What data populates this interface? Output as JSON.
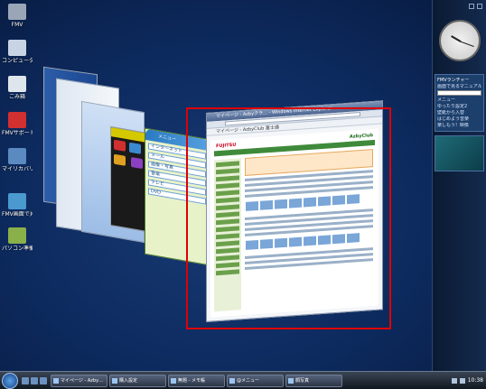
{
  "desktop_icons": [
    {
      "label": "FMV",
      "icon": "computer-icon",
      "color": "#9aa6b8"
    },
    {
      "label": "コンピュータ",
      "icon": "computer-icon",
      "color": "#c8d4e4"
    },
    {
      "label": "ごみ箱",
      "icon": "recycle-bin-icon",
      "color": "#dfe5ec"
    },
    {
      "label": "FMVサポートナビ",
      "icon": "support-navi-icon",
      "color": "#d03030"
    },
    {
      "label": "マイリカバリ",
      "icon": "recovery-icon",
      "color": "#5a8ac0"
    },
    {
      "label": "FMV画面で見るマニュアル",
      "icon": "manual-icon",
      "color": "#4a9ad0"
    },
    {
      "label": "パソコン準備ばっちりガ",
      "icon": "setup-guide-icon",
      "color": "#8ab04a"
    }
  ],
  "browser": {
    "title": "マイページ - Azbyクラ… - Windows Internet Explorer",
    "toolbar": "マイページ - AzbyClub 富士通",
    "brand": "FUJITSU",
    "brand2": "AzbyClub"
  },
  "flip_cards": {
    "menu_title": "メニュー",
    "menu_items": [
      "インターネット",
      "メール",
      "画像・写真",
      "音楽",
      "テレビ",
      "DVD"
    ]
  },
  "sidebar": {
    "fmv_title": "FMVランチャー",
    "fmv_items": [
      "画面で見るマニュアル",
      "メニュー",
      "ゆったり設定2",
      "壁紙から入替",
      "はじめよう音楽",
      "楽しもう！映像"
    ]
  },
  "taskbar": {
    "tasks": [
      "マイページ - Azby…",
      "購入設定",
      "無題 - メモ帳",
      "@メニュー",
      "顔写真"
    ],
    "time": "10:38"
  },
  "colors": {
    "selection": "#e00000",
    "desktop": "#0d2a5e"
  }
}
